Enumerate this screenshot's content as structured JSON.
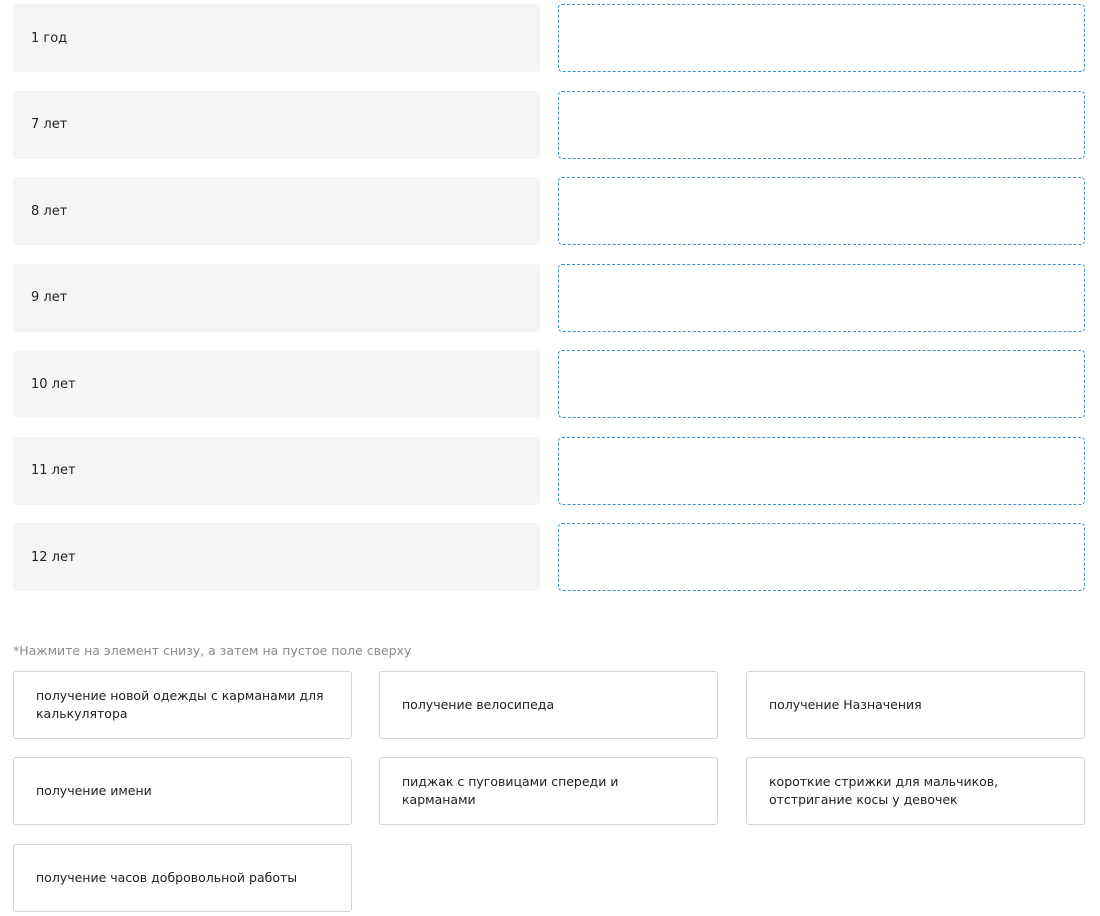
{
  "pairs": [
    {
      "label": "1 год"
    },
    {
      "label": "7 лет"
    },
    {
      "label": "8 лет"
    },
    {
      "label": "9 лет"
    },
    {
      "label": "10 лет"
    },
    {
      "label": "11 лет"
    },
    {
      "label": "12 лет"
    }
  ],
  "hint": "*Нажмите на элемент снизу, а затем на пустое поле сверху",
  "options": [
    {
      "label": "получение новой одежды с карманами для калькулятора"
    },
    {
      "label": "получение велосипеда"
    },
    {
      "label": "получение Назначения"
    },
    {
      "label": "получение имени"
    },
    {
      "label": "пиджак с пуговицами спереди и карманами"
    },
    {
      "label": "короткие стрижки для мальчиков, отстригание косы у девочек"
    },
    {
      "label": "получение часов добровольной работы"
    }
  ]
}
